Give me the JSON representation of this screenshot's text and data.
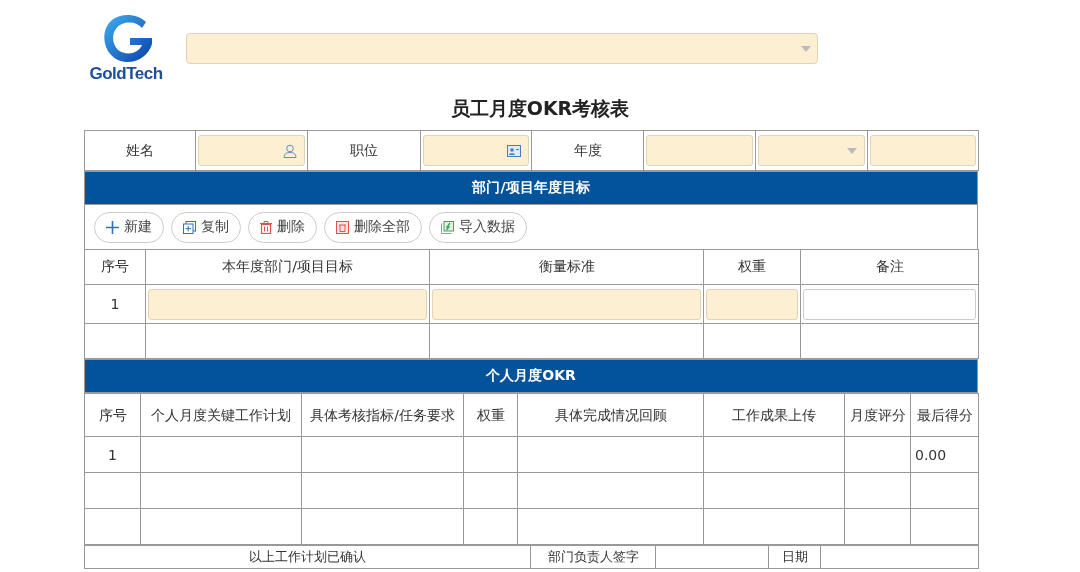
{
  "header": {
    "brand": "GoldTech",
    "selector": {
      "kind": "dropdown"
    }
  },
  "title": "员工月度OKR考核表",
  "info_row": [
    {
      "kind": "label",
      "text": "姓名"
    },
    {
      "kind": "person_field"
    },
    {
      "kind": "label",
      "text": "职位"
    },
    {
      "kind": "card_field"
    },
    {
      "kind": "label",
      "text": "年度"
    },
    {
      "kind": "text_field"
    },
    {
      "kind": "dropdown"
    },
    {
      "kind": "text_field"
    }
  ],
  "goals": {
    "title": "部门/项目年度目标",
    "toolbar": [
      {
        "kind": "add",
        "label": "新建"
      },
      {
        "kind": "copy",
        "label": "复制"
      },
      {
        "kind": "delete",
        "label": "删除"
      },
      {
        "kind": "delete_all",
        "label": "删除全部"
      },
      {
        "kind": "import",
        "label": "导入数据"
      }
    ],
    "columns": [
      "序号",
      "本年度部门/项目目标",
      "衡量标准",
      "权重",
      "备注"
    ],
    "rows": [
      {
        "kind": "entry",
        "no": "1",
        "inputs": [
          {
            "filled": true
          },
          {
            "filled": true
          },
          {
            "filled": true
          },
          {
            "filled": false
          }
        ]
      },
      {
        "kind": "blank"
      }
    ]
  },
  "okr": {
    "title": "个人月度OKR",
    "columns": [
      "序号",
      "个人月度关键工作计划",
      "具体考核指标/任务要求",
      "权重",
      "具体完成情况回顾",
      "工作成果上传",
      "月度评分",
      "最后得分"
    ],
    "rows": [
      {
        "kind": "entry",
        "no": "1",
        "final_score": "0.00"
      },
      {
        "kind": "blank"
      },
      {
        "kind": "blank"
      }
    ]
  },
  "footer": [
    {
      "kind": "label",
      "text": "以上工作计划已确认"
    },
    {
      "kind": "label",
      "text": "部门负责人签字"
    },
    {
      "kind": "empty"
    },
    {
      "kind": "label",
      "text": "日期"
    },
    {
      "kind": "empty"
    }
  ]
}
